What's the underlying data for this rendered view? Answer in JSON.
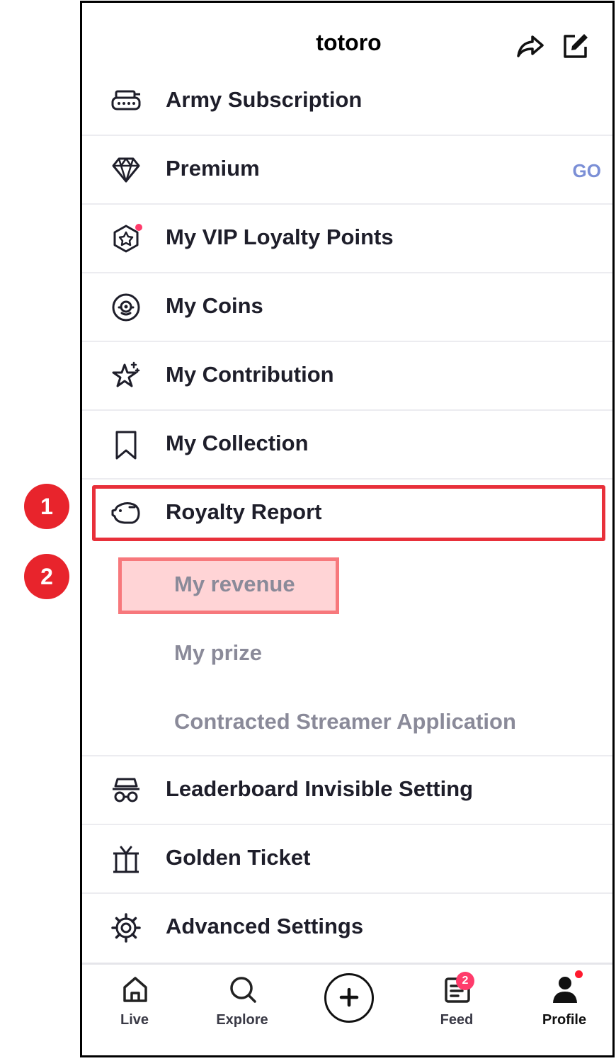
{
  "header": {
    "title": "totoro",
    "share_icon": "share-icon",
    "edit_icon": "edit-icon"
  },
  "menu": [
    {
      "label": "Army Subscription",
      "icon": "army-icon"
    },
    {
      "label": "Premium",
      "icon": "diamond-icon",
      "action": "GO"
    },
    {
      "label": "My VIP Loyalty Points",
      "icon": "vip-badge-icon"
    },
    {
      "label": "My Coins",
      "icon": "coin-icon"
    },
    {
      "label": "My Contribution",
      "icon": "star-sparkle-icon"
    },
    {
      "label": "My Collection",
      "icon": "bookmark-icon"
    },
    {
      "label": "Royalty Report",
      "icon": "piggy-bank-icon"
    },
    {
      "label": "Leaderboard Invisible Setting",
      "icon": "incognito-icon"
    },
    {
      "label": "Golden Ticket",
      "icon": "gift-icon"
    },
    {
      "label": "Advanced Settings",
      "icon": "gear-icon"
    }
  ],
  "submenu": [
    {
      "label": "My revenue"
    },
    {
      "label": "My prize"
    },
    {
      "label": "Contracted Streamer Application"
    }
  ],
  "annotations": [
    "1",
    "2"
  ],
  "tabbar": {
    "tabs": [
      {
        "label": "Live",
        "icon": "home-icon"
      },
      {
        "label": "Explore",
        "icon": "search-icon"
      },
      {
        "label": "",
        "icon": "plus-icon"
      },
      {
        "label": "Feed",
        "icon": "feed-icon",
        "badge": "2"
      },
      {
        "label": "Profile",
        "icon": "profile-icon"
      }
    ]
  },
  "colors": {
    "highlight_red": "#e8303a",
    "highlight_fill": "#ffd4d6",
    "go_blue": "#7b8fd6",
    "badge_pink": "#ff3b6b"
  }
}
